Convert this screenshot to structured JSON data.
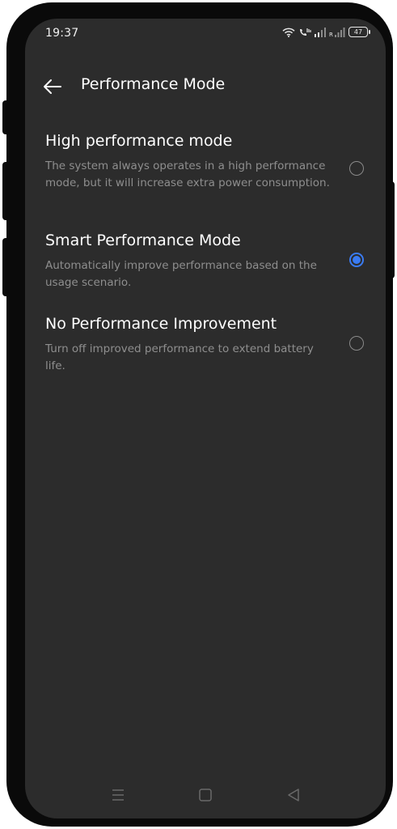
{
  "status_bar": {
    "time": "19:37",
    "battery_level": "47",
    "icons": [
      "wifi-icon",
      "volte-call-icon",
      "signal-icon",
      "roaming-signal-icon",
      "battery-icon"
    ]
  },
  "header": {
    "back_icon": "arrow-left-icon",
    "title": "Performance Mode"
  },
  "options": [
    {
      "title": "High performance mode",
      "description": "The system always operates in a high performance mode, but it will increase extra power consumption.",
      "selected": false
    },
    {
      "title": "Smart Performance Mode",
      "description": "Automatically improve performance based on the usage scenario.",
      "selected": true
    },
    {
      "title": "No Performance Improvement",
      "description": "Turn off improved performance to extend battery life.",
      "selected": false
    }
  ],
  "nav_bar": {
    "icons": [
      "menu-icon",
      "home-icon",
      "back-triangle-icon"
    ]
  },
  "colors": {
    "background": "#2c2c2c",
    "accent": "#3a7bf2",
    "secondary_text": "#8e8e8e"
  }
}
